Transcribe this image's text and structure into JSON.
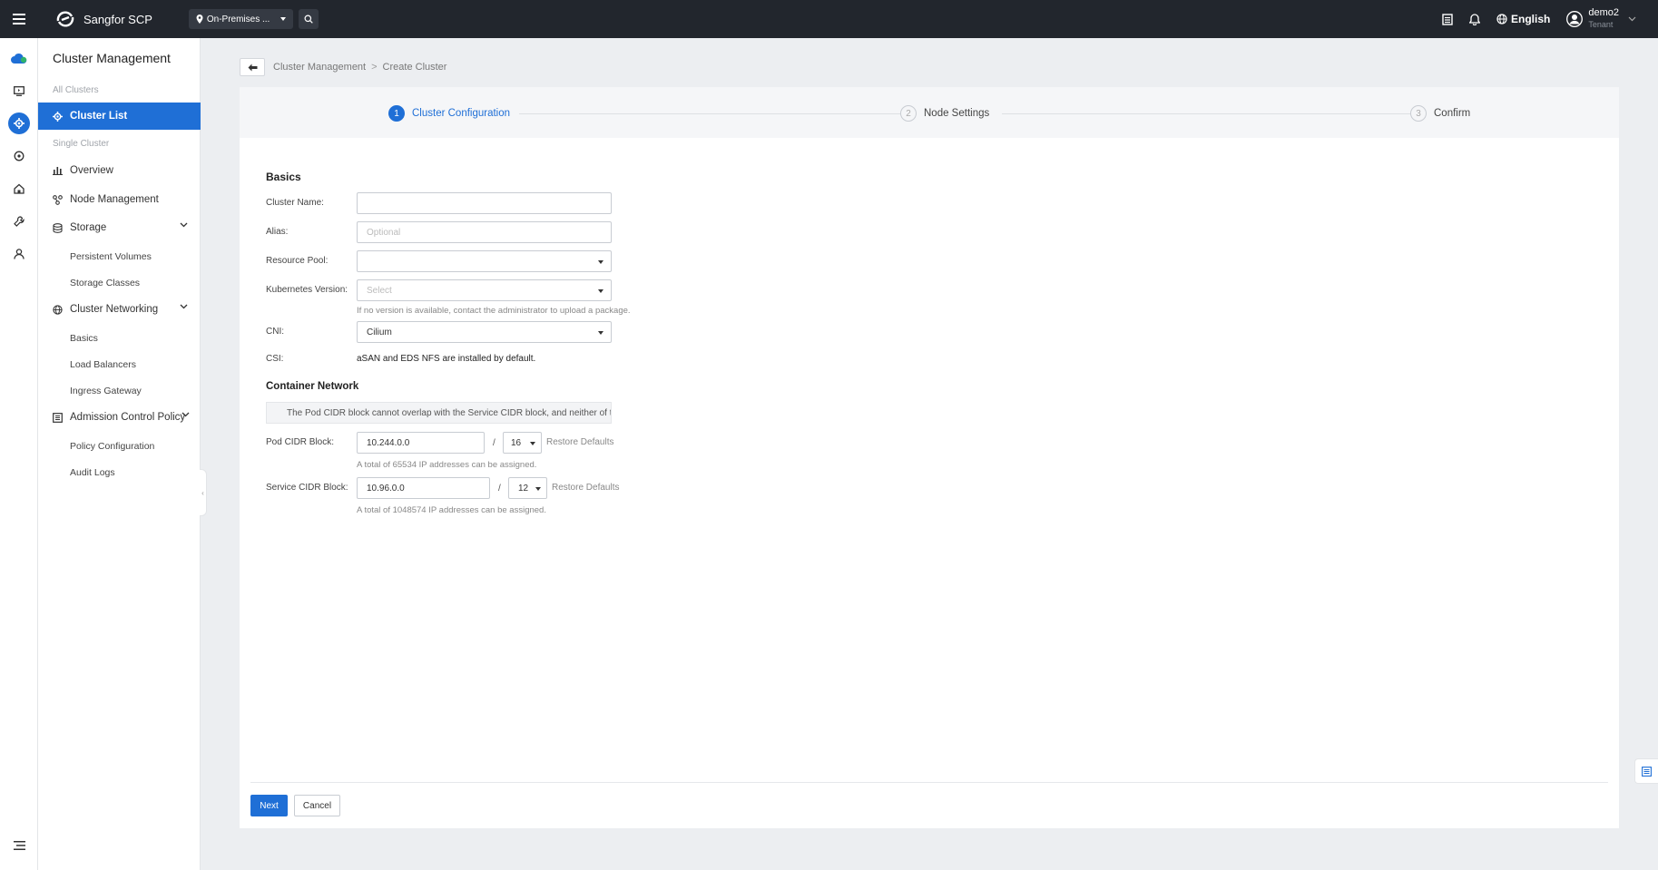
{
  "topbar": {
    "brand": "Sangfor SCP",
    "region": "On-Premises ...",
    "language": "English",
    "user": {
      "name": "demo2",
      "role": "Tenant"
    }
  },
  "sidebar": {
    "title": "Cluster Management",
    "group_all": "All Clusters",
    "cluster_list": "Cluster List",
    "group_single": "Single Cluster",
    "overview": "Overview",
    "node_management": "Node Management",
    "storage": "Storage",
    "persistent_volumes": "Persistent Volumes",
    "storage_classes": "Storage Classes",
    "cluster_networking": "Cluster Networking",
    "basics": "Basics",
    "load_balancers": "Load Balancers",
    "ingress_gateway": "Ingress Gateway",
    "admission_control_policy": "Admission Control Policy",
    "policy_configuration": "Policy Configuration",
    "audit_logs": "Audit Logs"
  },
  "breadcrumb": {
    "parent": "Cluster Management",
    "separator": ">",
    "current": "Create Cluster"
  },
  "steps": [
    {
      "num": "1",
      "label": "Cluster Configuration"
    },
    {
      "num": "2",
      "label": "Node Settings"
    },
    {
      "num": "3",
      "label": "Confirm"
    }
  ],
  "form": {
    "basics_title": "Basics",
    "cluster_name_label": "Cluster Name:",
    "cluster_name_value": "",
    "alias_label": "Alias:",
    "alias_placeholder": "Optional",
    "resource_pool_label": "Resource Pool:",
    "resource_pool_value": "",
    "k8s_version_label": "Kubernetes Version:",
    "k8s_version_placeholder": "Select",
    "k8s_version_hint": "If no version is available, contact the administrator to upload a package.",
    "cni_label": "CNI:",
    "cni_value": "Cilium",
    "csi_label": "CSI:",
    "csi_value": "aSAN and EDS NFS are installed by default.",
    "container_network_title": "Container Network",
    "notice": "The Pod CIDR block cannot overlap with the Service CIDR block, and neither of them can overlap ...",
    "pod_cidr_label": "Pod CIDR Block:",
    "pod_cidr_value": "10.244.0.0",
    "pod_cidr_mask": "16",
    "pod_cidr_hint": "A total of 65534 IP addresses can be assigned.",
    "service_cidr_label": "Service CIDR Block:",
    "service_cidr_value": "10.96.0.0",
    "service_cidr_mask": "12",
    "service_cidr_hint": "A total of 1048574 IP addresses can be assigned.",
    "slash": "/",
    "restore_defaults": "Restore Defaults"
  },
  "actions": {
    "next": "Next",
    "cancel": "Cancel"
  },
  "colors": {
    "primary": "#1f6fd6",
    "topbar": "#22262d"
  }
}
